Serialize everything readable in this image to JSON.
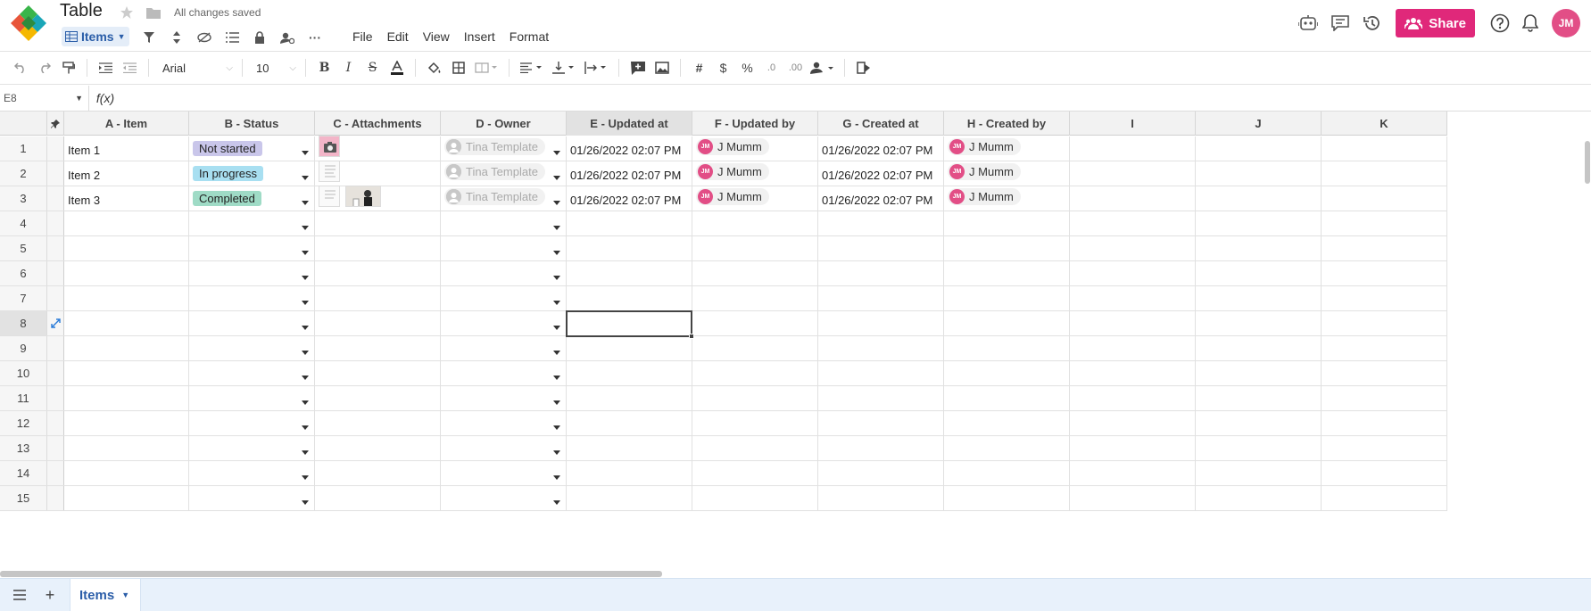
{
  "header": {
    "title": "Table",
    "save_status": "All changes saved",
    "view_label": "Items",
    "menu": [
      "File",
      "Edit",
      "View",
      "Insert",
      "Format"
    ],
    "share_label": "Share",
    "user_initials": "JM"
  },
  "toolbar": {
    "font": "Arial",
    "font_size": "10"
  },
  "formula_bar": {
    "cell_ref": "E8",
    "fx_label": "f(x)"
  },
  "grid": {
    "columns": [
      "A - Item",
      "B - Status",
      "C - Attachments",
      "D - Owner",
      "E - Updated at",
      "F - Updated by",
      "G - Created at",
      "H - Created by",
      "I",
      "J",
      "K"
    ],
    "row_numbers": [
      "1",
      "2",
      "3",
      "4",
      "5",
      "6",
      "7",
      "8",
      "9",
      "10",
      "11",
      "12",
      "13",
      "14",
      "15"
    ],
    "rows": [
      {
        "item": "Item 1",
        "status": "Not started",
        "status_color": "#c9c6ea",
        "owner": "Tina Template",
        "updated_at": "01/26/2022 02:07 PM",
        "updated_by": "J Mumm",
        "created_at": "01/26/2022 02:07 PM",
        "created_by": "J Mumm"
      },
      {
        "item": "Item 2",
        "status": "In progress",
        "status_color": "#a8dff1",
        "owner": "Tina Template",
        "updated_at": "01/26/2022 02:07 PM",
        "updated_by": "J Mumm",
        "created_at": "01/26/2022 02:07 PM",
        "created_by": "J Mumm"
      },
      {
        "item": "Item 3",
        "status": "Completed",
        "status_color": "#9fdbc6",
        "owner": "Tina Template",
        "updated_at": "01/26/2022 02:07 PM",
        "updated_by": "J Mumm",
        "created_at": "01/26/2022 02:07 PM",
        "created_by": "J Mumm"
      }
    ],
    "avatar_initials": "JM",
    "selected_cell": "E8"
  },
  "sheets": {
    "active": "Items"
  },
  "colors": {
    "accent": "#e0287a",
    "brand_blue": "#2a5da8"
  }
}
